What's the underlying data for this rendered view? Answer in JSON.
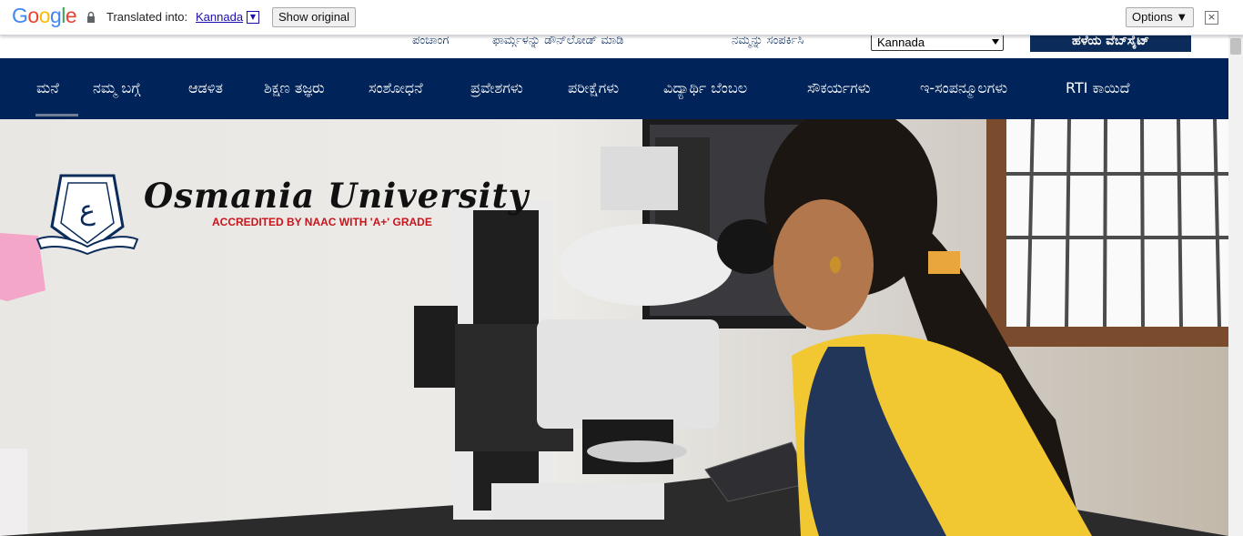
{
  "translate_bar": {
    "logo_text": "Google",
    "translated_label": "Translated into:",
    "language": "Kannada",
    "show_original": "Show original",
    "options": "Options ▼",
    "close": "×"
  },
  "top_links": [
    "ಪಂಚಾಂಗ",
    "ಫಾರ್ಮ್ಗಳನ್ನು ಡೌನ್‌ಲೋಡ್ ಮಾಡಿ",
    "ನಮ್ಮನ್ನು ಸಂಪರ್ಕಿಸಿ"
  ],
  "language_select": {
    "selected": "Kannada"
  },
  "old_site_button": "ಹಳೆಯ ವೆಬ್‌ಸೈಟ್",
  "nav": [
    "ಮನೆ",
    "ನಮ್ಮ ಬಗ್ಗೆ",
    "ಆಡಳಿತ",
    "ಶಿಕ್ಷಣ ತಜ್ಞರು",
    "ಸಂಶೋಧನೆ",
    "ಪ್ರವೇಶಗಳು",
    "ಪರೀಕ್ಷೆಗಳು",
    "ವಿದ್ಯಾರ್ಥಿ ಬೆಂಬಲ",
    "ಸೌಕರ್ಯಗಳು",
    "ಇ-ಸಂಪನ್ಮೂಲಗಳು",
    "RTI ಕಾಯಿದೆ"
  ],
  "hero": {
    "university_name": "Osmania University",
    "accreditation": "ACCREDITED BY NAAC WITH 'A+' GRADE",
    "seal_text": "OSMANIA UNIVERSITY"
  },
  "colors": {
    "nav_bg": "#00235a",
    "accent_red": "#c8141c",
    "link_blue": "#1a0dab"
  }
}
